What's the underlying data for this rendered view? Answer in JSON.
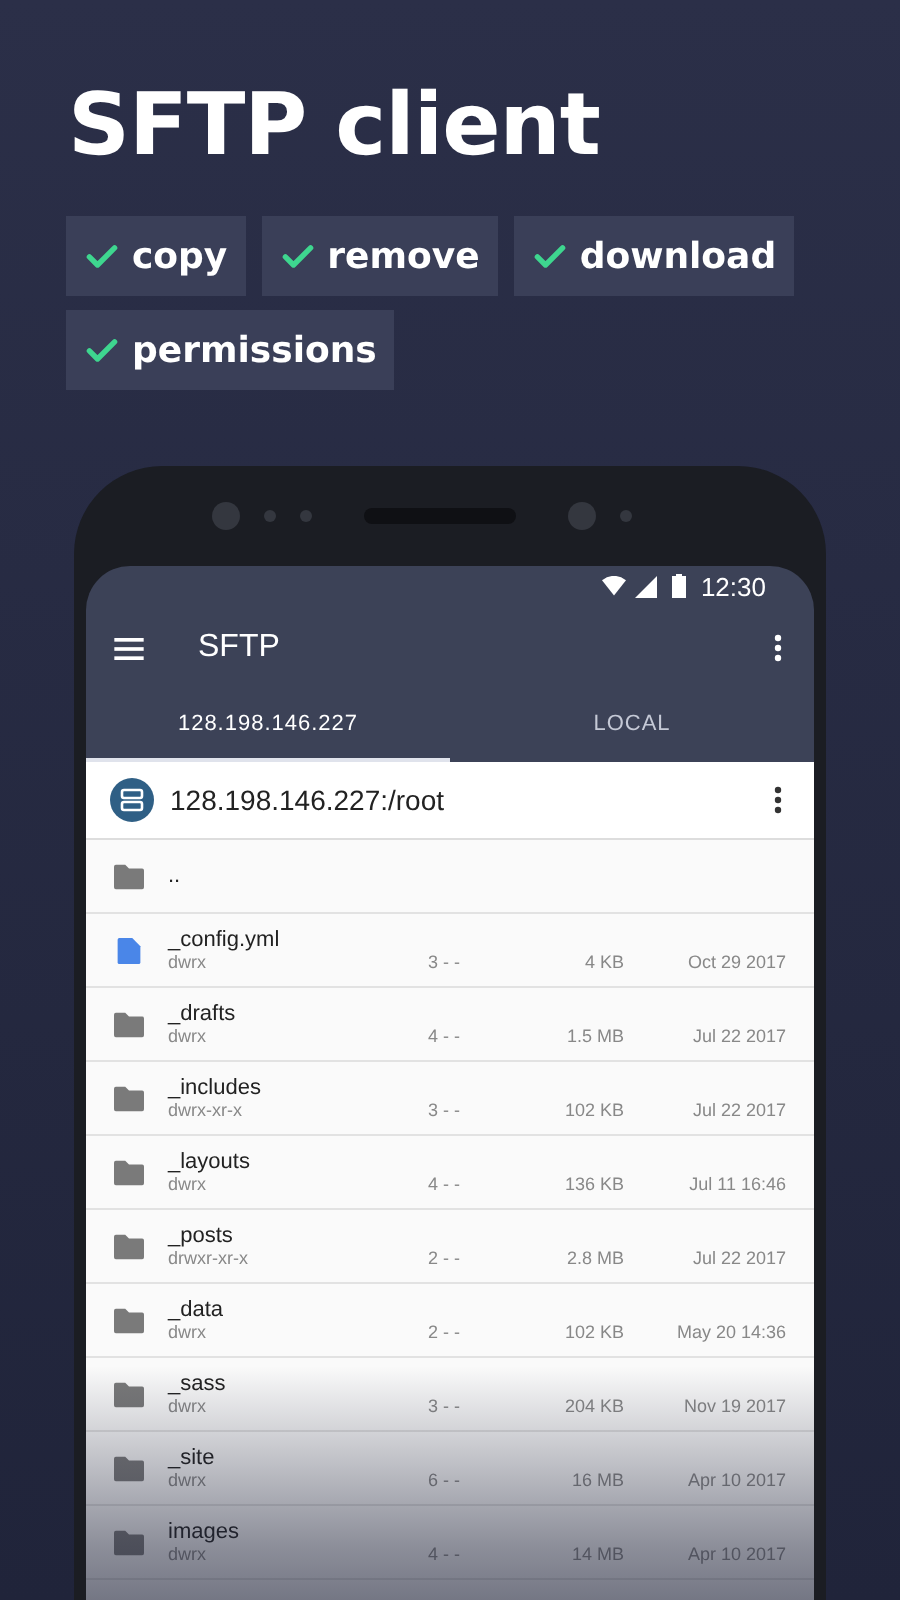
{
  "headline": "SFTP client",
  "features": [
    {
      "label": "copy"
    },
    {
      "label": "remove"
    },
    {
      "label": "download"
    },
    {
      "label": "permissions"
    }
  ],
  "status_bar": {
    "time": "12:30"
  },
  "toolbar": {
    "title": "SFTP"
  },
  "tabs": [
    {
      "label": "128.198.146.227",
      "selected": true
    },
    {
      "label": "LOCAL",
      "selected": false
    }
  ],
  "path": "128.198.146.227:/root",
  "files": [
    {
      "kind": "parent",
      "name": ".."
    },
    {
      "kind": "file",
      "name": "_config.yml",
      "perms": "dwrx",
      "links": "3 - -",
      "size": "4 KB",
      "date": "Oct 29 2017"
    },
    {
      "kind": "folder",
      "name": "_drafts",
      "perms": "dwrx",
      "links": "4 - -",
      "size": "1.5 MB",
      "date": "Jul 22 2017"
    },
    {
      "kind": "folder",
      "name": "_includes",
      "perms": "dwrx-xr-x",
      "links": "3 - -",
      "size": "102 KB",
      "date": "Jul 22 2017"
    },
    {
      "kind": "folder",
      "name": "_layouts",
      "perms": "dwrx",
      "links": "4 - -",
      "size": "136 KB",
      "date": "Jul 11 16:46"
    },
    {
      "kind": "folder",
      "name": "_posts",
      "perms": "drwxr-xr-x",
      "links": "2 - -",
      "size": "2.8 MB",
      "date": "Jul 22 2017"
    },
    {
      "kind": "folder",
      "name": "_data",
      "perms": "dwrx",
      "links": "2 - -",
      "size": "102 KB",
      "date": "May 20 14:36"
    },
    {
      "kind": "folder",
      "name": "_sass",
      "perms": "dwrx",
      "links": "3 - -",
      "size": "204 KB",
      "date": "Nov 19 2017"
    },
    {
      "kind": "folder",
      "name": "_site",
      "perms": "dwrx",
      "links": "6 - -",
      "size": "16 MB",
      "date": "Apr 10 2017"
    },
    {
      "kind": "folder",
      "name": "images",
      "perms": "dwrx",
      "links": "4 - -",
      "size": "14 MB",
      "date": "Apr 10 2017"
    }
  ]
}
